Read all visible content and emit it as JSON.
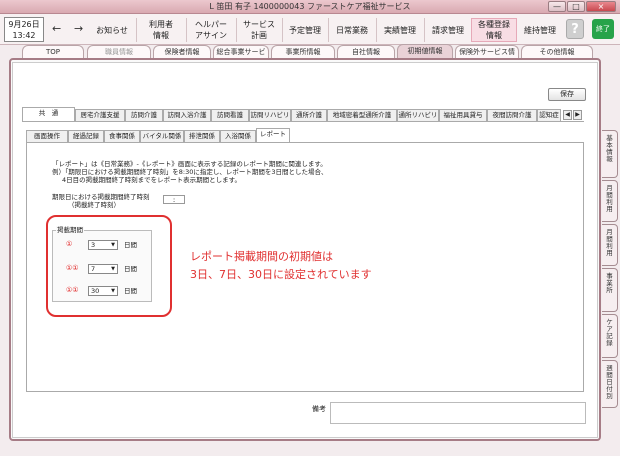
{
  "window": {
    "title": "L 笛田 有子 1400000043 ファーストケア福祉サービス",
    "minimize": "—",
    "maximize": "□",
    "close": "×"
  },
  "datetime": {
    "date": "9月26日",
    "time": "13:42"
  },
  "toolbar": {
    "back_icon": "arrow-left",
    "forward_icon": "arrow-right",
    "items": [
      "お知らせ",
      "利用者\n情報",
      "ヘルパー\nアサイン",
      "サービス\n計画",
      "予定管理",
      "日常業務",
      "実績管理",
      "請求管理",
      "各種登録\n情報",
      "維持管理"
    ],
    "help": "?",
    "exit": "終了"
  },
  "page_tabs": [
    "TOP",
    "職員情報",
    "保険者情報",
    "総合事業サービス",
    "事業所情報",
    "自社情報",
    "初期値情報",
    "保険外サービス情報",
    "その他情報"
  ],
  "save_label": "保存",
  "category_tabs": [
    "共　通",
    "居宅介護支援",
    "訪問介護",
    "訪問入浴介護",
    "訪問看護",
    "訪問リハビリ",
    "通所介護",
    "地域密着型通所介護",
    "通所リハビリ",
    "福祉用具貸与",
    "夜間訪問介護",
    "認知症"
  ],
  "sub_tabs": [
    "画面操作",
    "経過記録",
    "食事関係",
    "バイタル関係",
    "排泄関係",
    "入浴関係",
    "レポート"
  ],
  "description": [
    "「レポート」は《日常業務》-《レポート》画面に表示する記録のレポート期間に関連します。",
    "例）「期限日における掲載期間終了時刻」を8:30に指定し、レポート期間を3日間とした場合、",
    "4日目の掲載期間終了時刻までをレポート表示期間とします。"
  ],
  "cutoff": {
    "label_line1": "期限日における掲載期間終了時刻",
    "label_line2": "（掲載終了時刻）",
    "value": ":"
  },
  "period_group": {
    "title": "掲載期間",
    "rows": [
      {
        "marker": "①",
        "value": "3",
        "unit": "日間"
      },
      {
        "marker": "①①",
        "value": "7",
        "unit": "日間"
      },
      {
        "marker": "①①",
        "value": "30",
        "unit": "日間"
      }
    ]
  },
  "annotation": {
    "line1": "レポート掲載期間の初期値は",
    "line2": "3日、7日、30日に設定されています"
  },
  "remark_label": "備考",
  "right_tabs": [
    "基本情報",
    "月間利用",
    "月間利用",
    "事業所",
    "ケア記録",
    "週間日付別"
  ]
}
